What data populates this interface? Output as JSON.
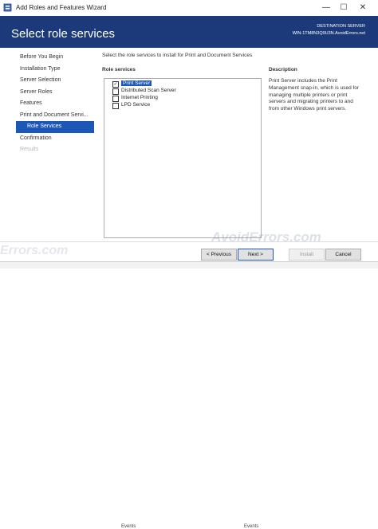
{
  "window": {
    "title": "Add Roles and Features Wizard",
    "minimize": "—",
    "maximize": "☐",
    "close": "✕"
  },
  "header": {
    "page_title": "Select role services",
    "destination_label": "DESTINATION SERVER",
    "destination_server": "WIN-1TM8N3Q9U3N.AvoidErrors.net",
    "watermark": "AvoidErrors.com"
  },
  "sidebar": {
    "items": [
      {
        "label": "Before You Begin"
      },
      {
        "label": "Installation Type"
      },
      {
        "label": "Server Selection"
      },
      {
        "label": "Server Roles"
      },
      {
        "label": "Features"
      },
      {
        "label": "Print and Document Servi..."
      },
      {
        "label": "Role Services"
      },
      {
        "label": "Confirmation"
      },
      {
        "label": "Results"
      }
    ]
  },
  "content": {
    "intro": "Select the role services to install for Print and Document Services",
    "services_heading": "Role services",
    "description_heading": "Description",
    "services": [
      {
        "label": "Print Server",
        "checked": true
      },
      {
        "label": "Distributed Scan Server",
        "checked": false
      },
      {
        "label": "Internet Printing",
        "checked": false
      },
      {
        "label": "LPD Service",
        "checked": false
      }
    ],
    "description": "Print Server includes the Print Management snap-in, which is used for managing multiple printers or print servers and migrating printers to and from other Windows print servers."
  },
  "buttons": {
    "previous": "< Previous",
    "next": "Next >",
    "install": "Install",
    "cancel": "Cancel"
  },
  "footer": {
    "watermark": "AvoidErrors.com",
    "watermark_left": "Errors.com",
    "events_1": "Events",
    "events_2": "Events"
  },
  "colors": {
    "header_bg": "#1c3a7a",
    "selection": "#1c57b8"
  }
}
